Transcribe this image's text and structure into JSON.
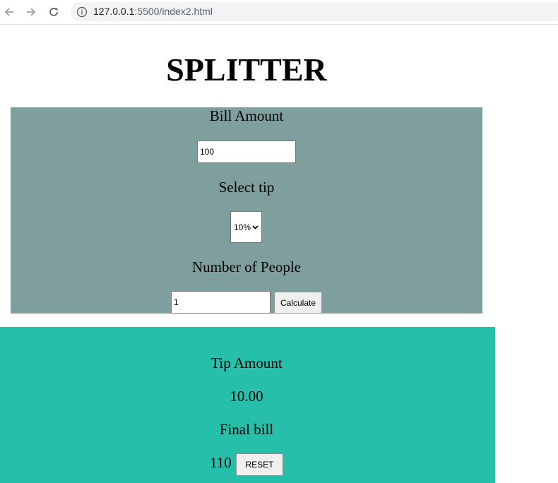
{
  "browser": {
    "url_host": "127.0.0.1",
    "url_rest": ":5500/index2.html"
  },
  "page": {
    "title": "SPLITTER"
  },
  "form": {
    "bill_label": "Bill Amount",
    "bill_value": "100",
    "tip_label": "Select tip",
    "tip_selected": "10%",
    "people_label": "Number of People",
    "people_value": "1",
    "calculate_label": "Calculate"
  },
  "results": {
    "tip_label": "Tip Amount",
    "tip_value": "10.00",
    "final_label": "Final bill",
    "final_value": "110",
    "reset_label": "RESET"
  },
  "colors": {
    "input_panel": "#7f9e9e",
    "result_panel": "#26c0aa"
  }
}
